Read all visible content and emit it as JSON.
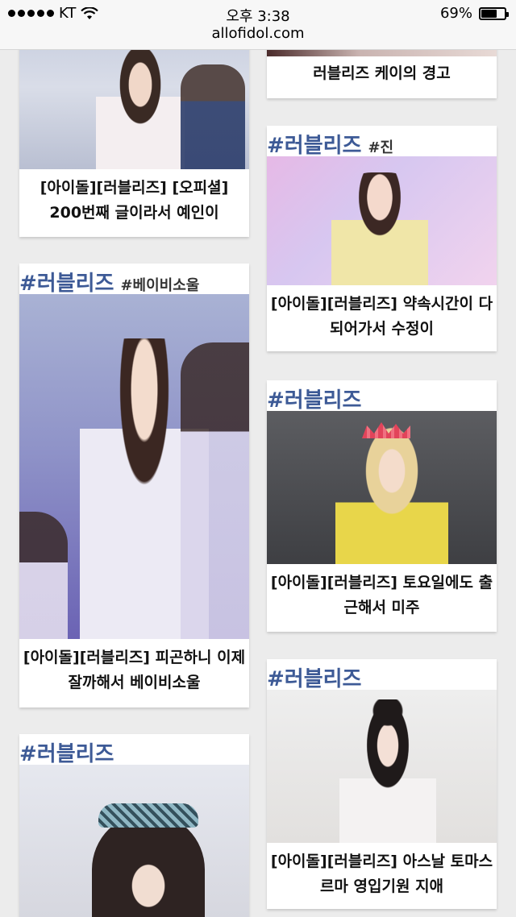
{
  "status_bar": {
    "carrier": "KT",
    "time": "오후 3:38",
    "battery": "69%",
    "battery_level": 0.69
  },
  "browser": {
    "url": "allofidol.com"
  },
  "cards": [
    {
      "tag": "",
      "subtag": "",
      "title": "[아이돌][러블리즈] [오피셜] 200번째 글이라서 예인이"
    },
    {
      "tag": "",
      "subtag": "",
      "title": "러블리즈 케이의 경고"
    },
    {
      "tag": "#러블리즈",
      "subtag": "#진",
      "title": "[아이돌][러블리즈] 약속시간이 다되어가서 수정이"
    },
    {
      "tag": "#러블리즈",
      "subtag": "#베이비소울",
      "title": "[아이돌][러블리즈] 피곤하니 이제 잘까해서 베이비소울"
    },
    {
      "tag": "#러블리즈",
      "subtag": "",
      "title": "[아이돌][러블리즈] 토요일에도 출근해서 미주"
    },
    {
      "tag": "#러블리즈",
      "subtag": "",
      "title": "[아이돌][러블리즈] 아스날 토마스르마 영입기원 지애"
    },
    {
      "tag": "#러블리즈",
      "subtag": "",
      "title": ""
    }
  ]
}
